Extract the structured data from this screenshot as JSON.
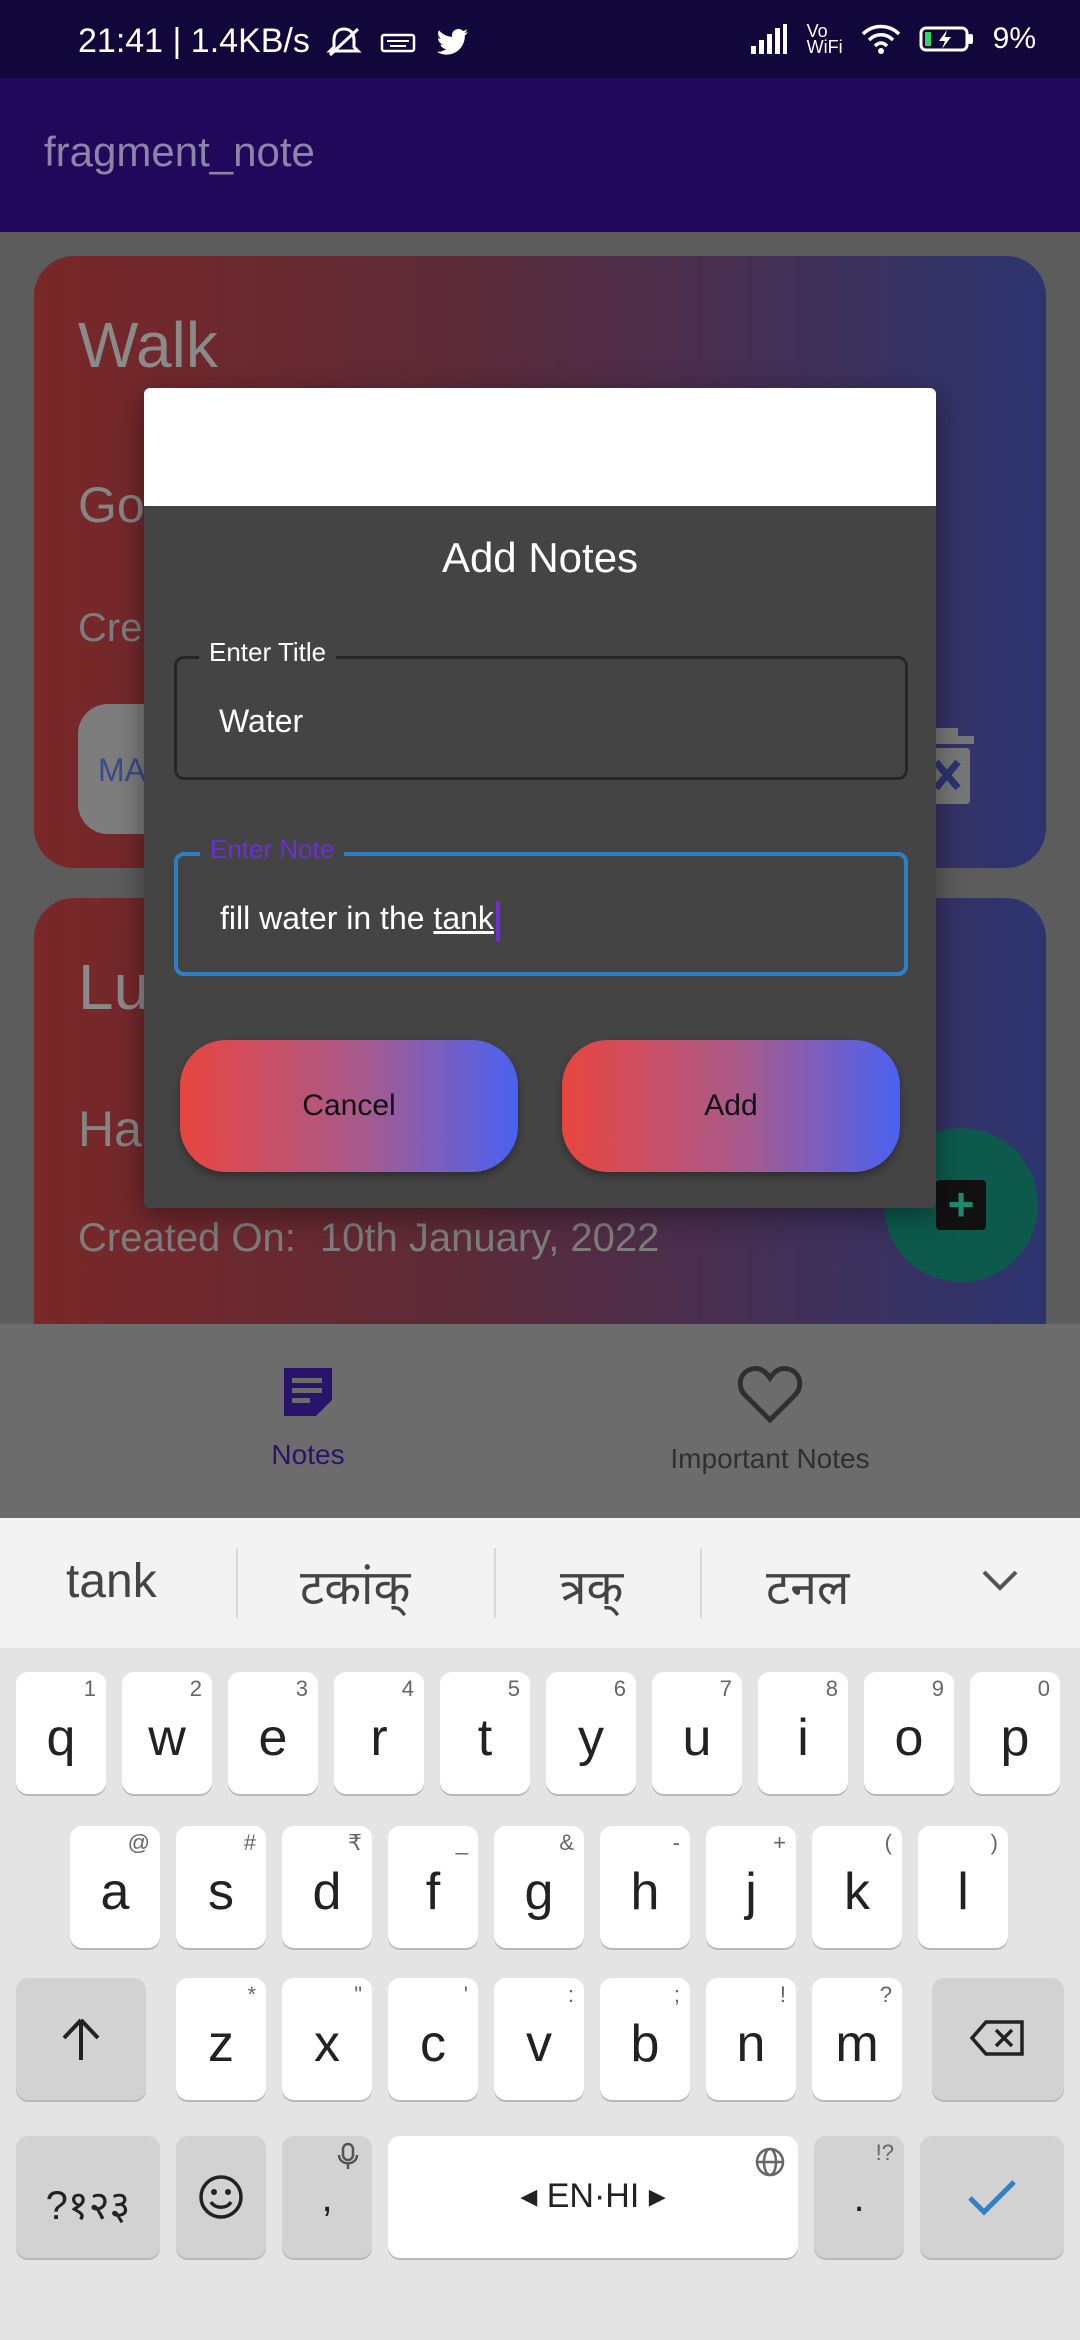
{
  "status": {
    "time_speed": "21:41 | 1.4KB/s",
    "net_label": "Vo WiFi",
    "battery": "9%"
  },
  "appbar": {
    "title": "fragment_note"
  },
  "cards": [
    {
      "title": "Walk",
      "subtitle": "Go",
      "created": "Cre",
      "button": "MA"
    },
    {
      "title": "Lu",
      "subtitle": "Ha",
      "created_label": "Created On:",
      "created_date": "10th January, 2022"
    }
  ],
  "nav": {
    "notes": "Notes",
    "important": "Important Notes"
  },
  "dialog": {
    "title": "Add Notes",
    "title_field": {
      "label": "Enter Title",
      "value": "Water"
    },
    "note_field": {
      "label": "Enter Note",
      "value_prefix": "fill water in the ",
      "value_word": "tank"
    },
    "cancel": "Cancel",
    "add": "Add"
  },
  "keyboard": {
    "suggestions": [
      "tank",
      "टकांक्",
      "त्रक्",
      "टनल"
    ],
    "row1": [
      {
        "k": "q",
        "h": "1"
      },
      {
        "k": "w",
        "h": "2"
      },
      {
        "k": "e",
        "h": "3"
      },
      {
        "k": "r",
        "h": "4"
      },
      {
        "k": "t",
        "h": "5"
      },
      {
        "k": "y",
        "h": "6"
      },
      {
        "k": "u",
        "h": "7"
      },
      {
        "k": "i",
        "h": "8"
      },
      {
        "k": "o",
        "h": "9"
      },
      {
        "k": "p",
        "h": "0"
      }
    ],
    "row2": [
      {
        "k": "a",
        "h": "@"
      },
      {
        "k": "s",
        "h": "#"
      },
      {
        "k": "d",
        "h": "₹"
      },
      {
        "k": "f",
        "h": "_"
      },
      {
        "k": "g",
        "h": "&"
      },
      {
        "k": "h",
        "h": "-"
      },
      {
        "k": "j",
        "h": "+"
      },
      {
        "k": "k",
        "h": "("
      },
      {
        "k": "l",
        "h": ")"
      }
    ],
    "row3": [
      {
        "k": "z",
        "h": "*"
      },
      {
        "k": "x",
        "h": "\""
      },
      {
        "k": "c",
        "h": "'"
      },
      {
        "k": "v",
        "h": ":"
      },
      {
        "k": "b",
        "h": ";"
      },
      {
        "k": "n",
        "h": "!"
      },
      {
        "k": "m",
        "h": "?"
      }
    ],
    "symbols": "?१२३",
    "comma": ",",
    "space": "EN·HI",
    "period": ".",
    "period_hint": "!?"
  }
}
